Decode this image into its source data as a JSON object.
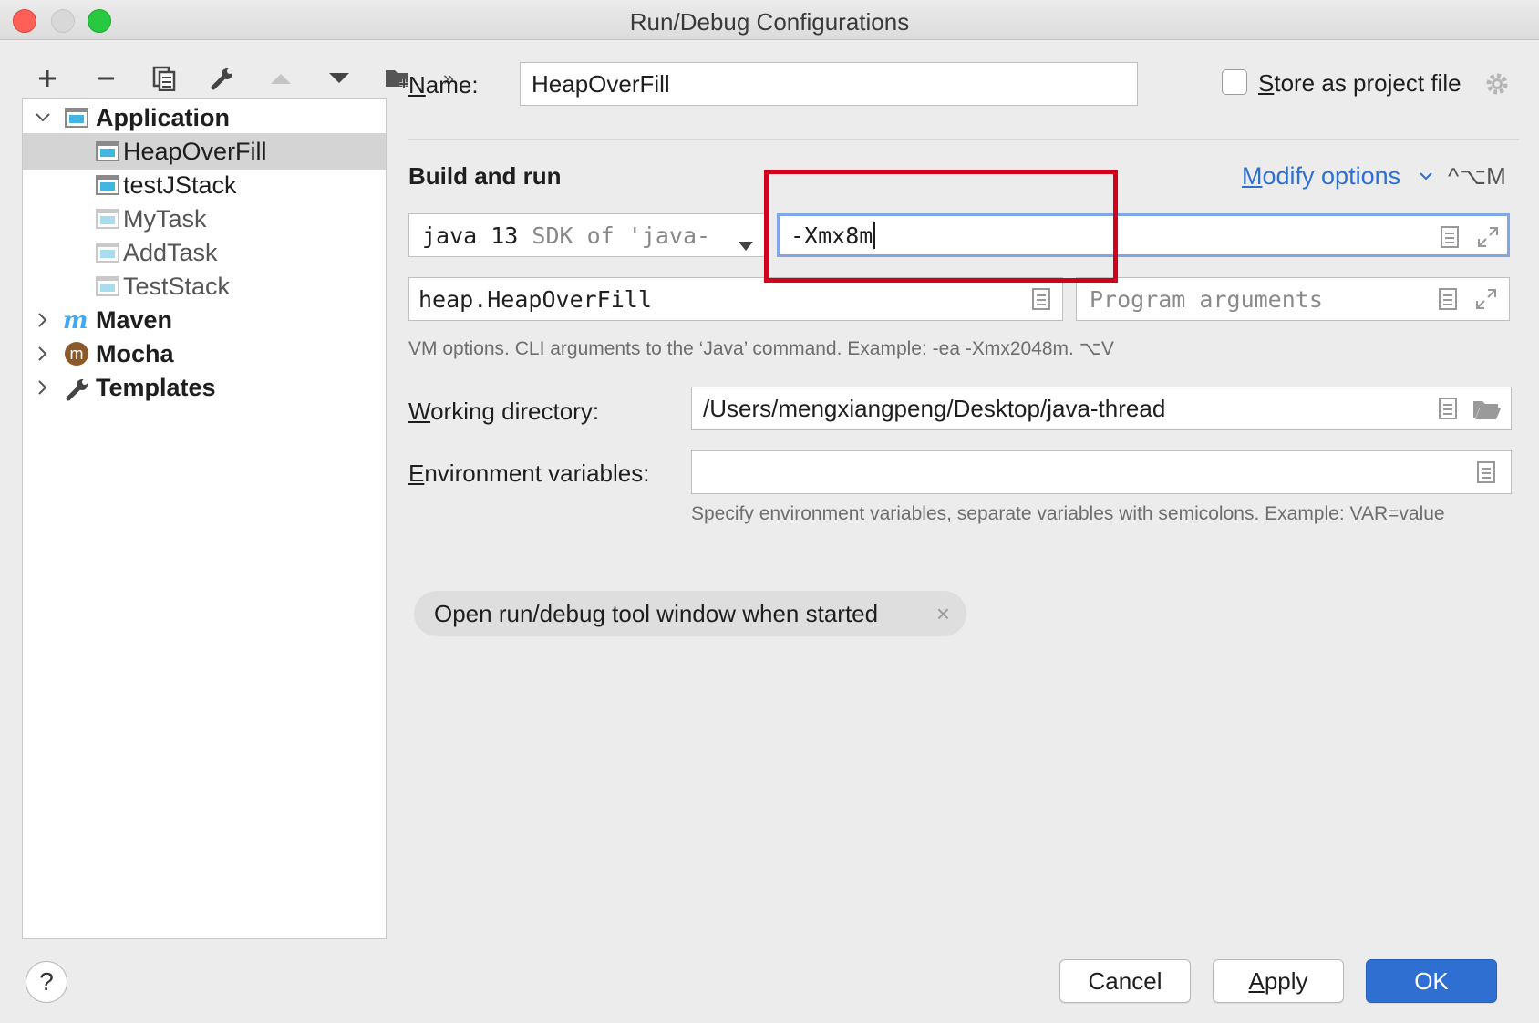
{
  "window": {
    "title": "Run/Debug Configurations"
  },
  "toolbar": {
    "icons": [
      "add-icon",
      "remove-icon",
      "copy-icon",
      "wrench-icon",
      "move-up-icon",
      "move-down-icon",
      "new-folder-icon",
      "more-icon"
    ],
    "more": "»"
  },
  "tree": {
    "application": "Application",
    "items": [
      "HeapOverFill",
      "testJStack",
      "MyTask",
      "AddTask",
      "TestStack"
    ],
    "maven": "Maven",
    "mocha": "Mocha",
    "mocha_icon_letter": "m",
    "templates": "Templates"
  },
  "name": {
    "label_first": "N",
    "label_rest": "ame:",
    "value": "HeapOverFill"
  },
  "store": {
    "label_first": "S",
    "label_rest": "tore as project file",
    "checked": false
  },
  "build": {
    "title": "Build and run",
    "modify_first": "M",
    "modify_rest": "odify options",
    "modify_shortcut": "^⌥M",
    "sdk_value_main": "java 13",
    "sdk_value_dim": " SDK of 'java-",
    "vm_options": "-Xmx8m",
    "main_class": "heap.HeapOverFill",
    "program_args_placeholder": "Program arguments",
    "vm_hint": "VM options. CLI arguments to the ‘Java’ command. Example: -ea -Xmx2048m. ⌥V"
  },
  "working_dir": {
    "label_first": "W",
    "label_rest": "orking directory:",
    "value": "/Users/mengxiangpeng/Desktop/java-thread"
  },
  "env": {
    "label_first": "E",
    "label_rest": "nvironment variables:",
    "value": "",
    "hint": "Specify environment variables, separate variables with semicolons. Example: VAR=value"
  },
  "chip": {
    "label": "Open run/debug tool window when started",
    "close": "×"
  },
  "buttons": {
    "cancel": "Cancel",
    "apply_first": "A",
    "apply_rest": "pply",
    "ok": "OK",
    "help": "?"
  },
  "colors": {
    "accent": "#2f6fd1",
    "highlight": "#d0021b",
    "selection": "#d4d4d4"
  }
}
